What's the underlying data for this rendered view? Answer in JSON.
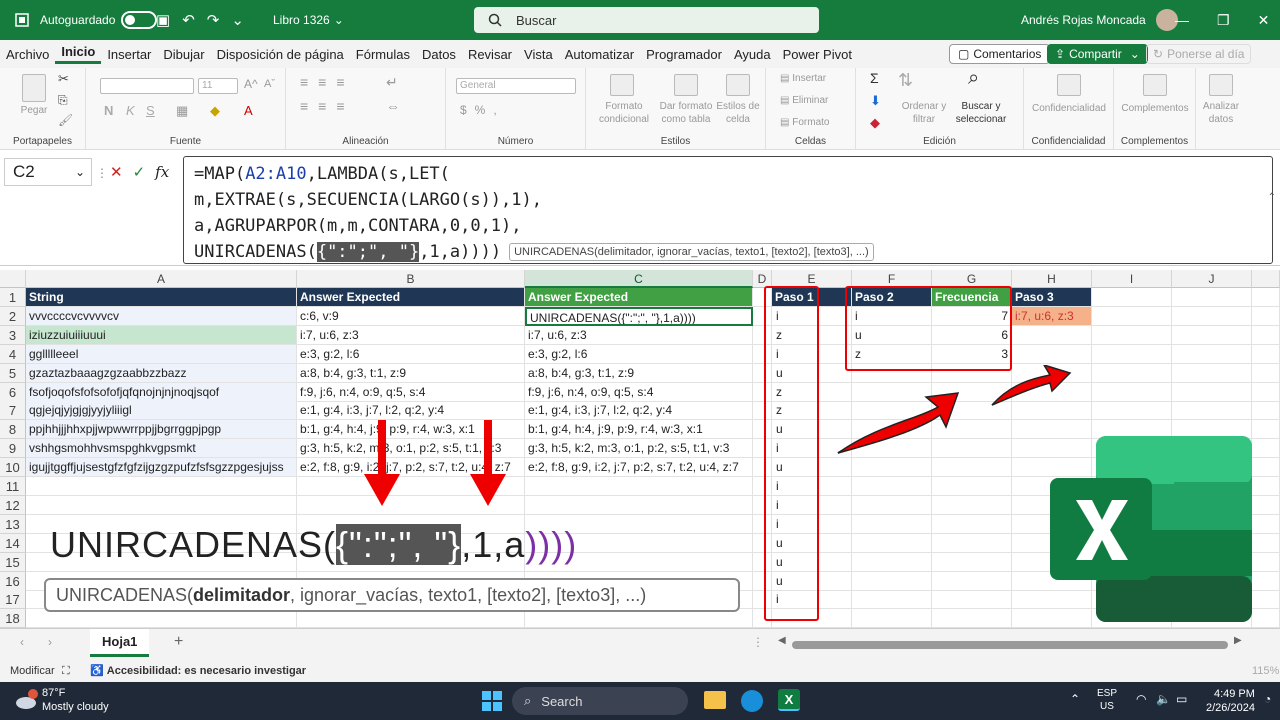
{
  "titlebar": {
    "autosave_label": "Autoguardado",
    "file_name": "Libro 1326",
    "search_placeholder": "Buscar",
    "user_name": "Andrés Rojas Moncada"
  },
  "menu": {
    "items": [
      "Archivo",
      "Inicio",
      "Insertar",
      "Dibujar",
      "Disposición de página",
      "Fórmulas",
      "Datos",
      "Revisar",
      "Vista",
      "Automatizar",
      "Programador",
      "Ayuda",
      "Power Pivot"
    ],
    "comments_label": "Comentarios",
    "share_label": "Compartir",
    "meet_label": "Ponerse al día"
  },
  "ribbon": {
    "groups": [
      "Portapapeles",
      "Fuente",
      "Alineación",
      "Número",
      "Estilos",
      "Celdas",
      "Edición",
      "Confidencialidad",
      "Complementos"
    ],
    "paste_label": "Pegar",
    "font_size": "11",
    "number_format": "General",
    "cond_format": "Formato condicional",
    "format_table": "Dar formato como tabla",
    "cell_styles": "Estilos de celda",
    "insert": "Insertar",
    "delete": "Eliminar",
    "format": "Formato",
    "sort_filter": "Ordenar y filtrar",
    "find_select": "Buscar y seleccionar",
    "confidentiality": "Confidencialidad",
    "addins": "Complementos",
    "analyze": "Analizar datos"
  },
  "formula_bar": {
    "name_box": "C2",
    "fx": "fx",
    "line1_a": "=MAP(",
    "line1_b": "A2:A10",
    "line1_c": ",LAMBDA(s,LET(",
    "line2": "m,EXTRAE(s,SECUENCIA(LARGO(s)),1),",
    "line3": "a,AGRUPARPOR(m,m,CONTARA,0,0,1),",
    "line4_a": "UNIRCADENAS(",
    "line4_b": "{\":\";\", \"}",
    "line4_c": ",1,a))))",
    "tooltip": "UNIRCADENAS(delimitador, ignorar_vacías, texto1, [texto2], [texto3], ...)"
  },
  "columns": [
    "A",
    "B",
    "C",
    "D",
    "E",
    "F",
    "G",
    "H",
    "I",
    "J"
  ],
  "rows": [
    "1",
    "2",
    "3",
    "4",
    "5",
    "6",
    "7",
    "8",
    "9",
    "10",
    "11",
    "12",
    "13",
    "14",
    "15",
    "16",
    "17",
    "18"
  ],
  "table": {
    "header_a": "String",
    "header_b": "Answer Expected",
    "header_c": "Answer Expected",
    "col_a": [
      "vvvccccvcvvvvcv",
      "iziuzzuiuiiiuuui",
      "ggllllleeel",
      "gzaztazbaaagzgzaabbzzbazz",
      "fsofjoqofsfofsofofjqfqnojnjnjnoqjsqof",
      "qgjejqjyjgjgjyyjyliiigl",
      "ppjhhjjjhhxpjjwpwwrrppjjbgrrggpjpgp",
      "vshhgsmohhvsmspghkvgpsmkt",
      "igujjtggffjujsestgfzfgfzijgzgzpufzfsfsgzzpgesjujss"
    ],
    "col_b": [
      "c:6, v:9",
      "i:7, u:6, z:3",
      "e:3, g:2, l:6",
      "a:8, b:4, g:3, t:1, z:9",
      "f:9, j:6, n:4, o:9, q:5, s:4",
      "e:1, g:4, i:3, j:7, l:2, q:2, y:4",
      "b:1, g:4, h:4, j:9, p:9, r:4, w:3, x:1",
      "g:3, h:5, k:2, m:3, o:1, p:2, s:5, t:1, v:3",
      "e:2, f:8, g:9, i:2, j:7, p:2, s:7, t:2, u:4, z:7"
    ],
    "col_c": [
      "UNIRCADENAS({\":\";\", \"},1,a))))",
      "i:7, u:6, z:3",
      "e:3, g:2, l:6",
      "a:8, b:4, g:3, t:1, z:9",
      "f:9, j:6, n:4, o:9, q:5, s:4",
      "e:1, g:4, i:3, j:7, l:2, q:2, y:4",
      "b:1, g:4, h:4, j:9, p:9, r:4, w:3, x:1",
      "g:3, h:5, k:2, m:3, o:1, p:2, s:5, t:1, v:3",
      "e:2, f:8, g:9, i:2, j:7, p:2, s:7, t:2, u:4, z:7"
    ]
  },
  "steps": {
    "paso1_header": "Paso 1",
    "paso1": [
      "i",
      "z",
      "i",
      "u",
      "z",
      "z",
      "u",
      "i",
      "u",
      "i",
      "i",
      "i",
      "u",
      "u",
      "u",
      "i"
    ],
    "paso2_header": "Paso 2",
    "freq_header": "Frecuencia",
    "paso2": [
      "i",
      "u",
      "z"
    ],
    "freq": [
      "7",
      "6",
      "3"
    ],
    "paso3_header": "Paso 3",
    "paso3": "i:7, u:6, z:3"
  },
  "overlay": {
    "big_a": "UNIRCADENAS(",
    "big_b": "{\":\";\", \"}",
    "big_c": ",1,a",
    "big_d": "))))",
    "tip_a": "UNIRCADENAS(",
    "tip_b": "delimitador",
    "tip_c": ", ignorar_vacías, texto1, [texto2], [texto3], ...)"
  },
  "sheet_tab": "Hoja1",
  "status": {
    "mode": "Modificar",
    "accessibility": "Accesibilidad: es necesario investigar",
    "zoom": "115%"
  },
  "taskbar": {
    "weather_temp": "87°F",
    "weather_desc": "Mostly cloudy",
    "search_label": "Search",
    "lang": "ESP",
    "lang2": "US",
    "time": "4:49 PM",
    "date": "2/26/2024"
  }
}
